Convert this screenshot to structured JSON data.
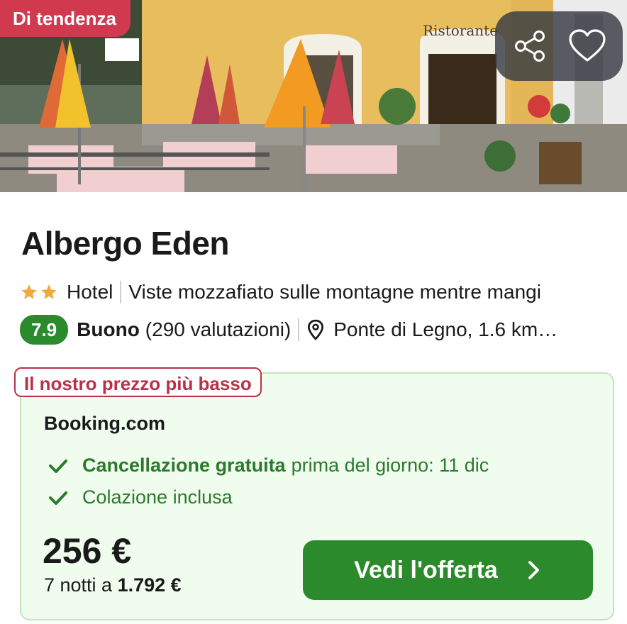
{
  "hero": {
    "trending_badge": "Di tendenza",
    "share_icon": "share-icon",
    "favorite_icon": "heart-icon"
  },
  "hotel": {
    "name": "Albergo Eden",
    "stars": 2,
    "type": "Hotel",
    "highlight": "Viste mozzafiato sulle montagne mentre mangi",
    "rating_score": "7.9",
    "rating_word": "Buono",
    "reviews": "(290 valutazioni)",
    "location": "Ponte di Legno, 1.6 km…"
  },
  "offer": {
    "tag": "Il nostro prezzo più basso",
    "provider": "Booking.com",
    "perks": [
      {
        "bold": "Cancellazione gratuita",
        "text": "prima del giorno: 11 dic"
      },
      {
        "bold": "",
        "text": "Colazione inclusa"
      }
    ],
    "price": "256 €",
    "total_prefix": "7 notti a",
    "total_value": "1.792 €",
    "cta_label": "Vedi l'offerta"
  },
  "colors": {
    "trending": "#d1394f",
    "score": "#2b8a2b",
    "offer_bg": "#effcee",
    "tag_red": "#b83247",
    "star": "#f2a93b"
  }
}
